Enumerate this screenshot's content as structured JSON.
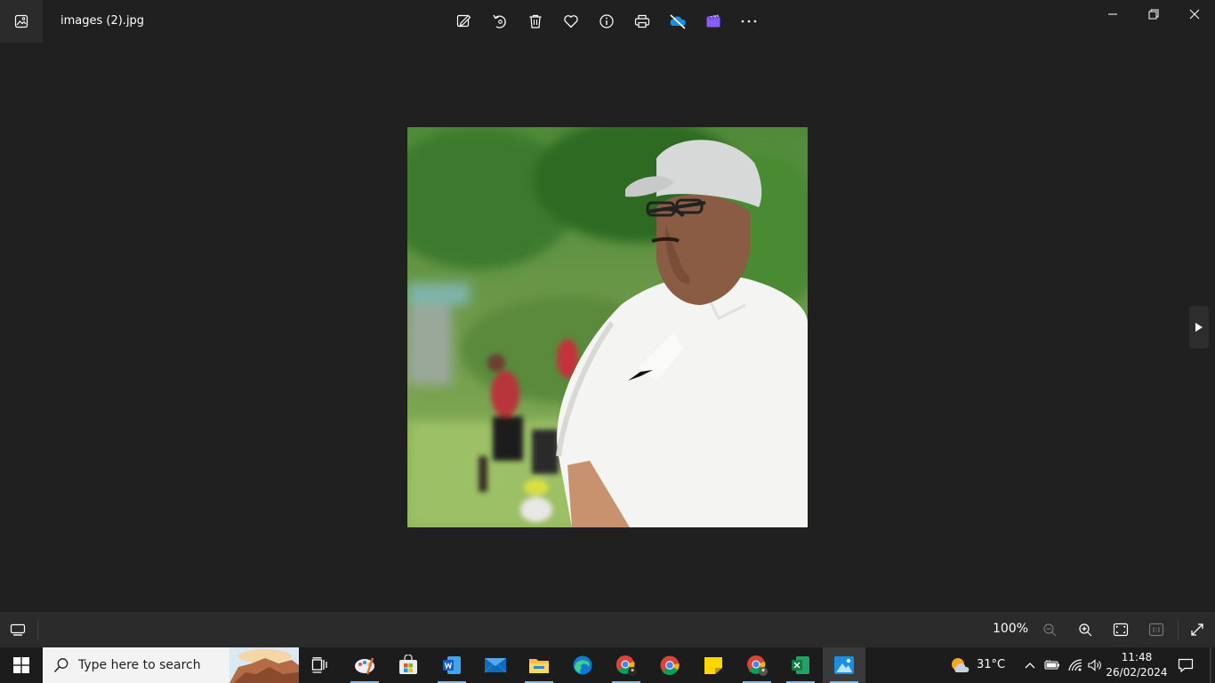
{
  "titlebar": {
    "file_name": "images (2).jpg",
    "toolbar_icons": [
      "edit-image-icon",
      "rotate-icon",
      "delete-icon",
      "favorite-icon",
      "info-icon",
      "print-icon",
      "onedrive-icon",
      "clipchamp-icon",
      "more-icon"
    ]
  },
  "bottombar": {
    "zoom_level": "100%"
  },
  "taskbar": {
    "search_placeholder": "Type here to search",
    "weather_temp": "31°C",
    "time": "11:48",
    "date": "26/02/2024",
    "apps": [
      "paint",
      "microsoft-store",
      "word",
      "mail",
      "file-explorer",
      "edge",
      "chrome-profile",
      "chrome",
      "sticky-notes",
      "chrome-profile-2",
      "excel",
      "photos"
    ]
  },
  "colors": {
    "background": "#202020",
    "bar": "#2b2b2b",
    "taskbar": "#1c1c1c",
    "accent": "#76b9ed"
  }
}
